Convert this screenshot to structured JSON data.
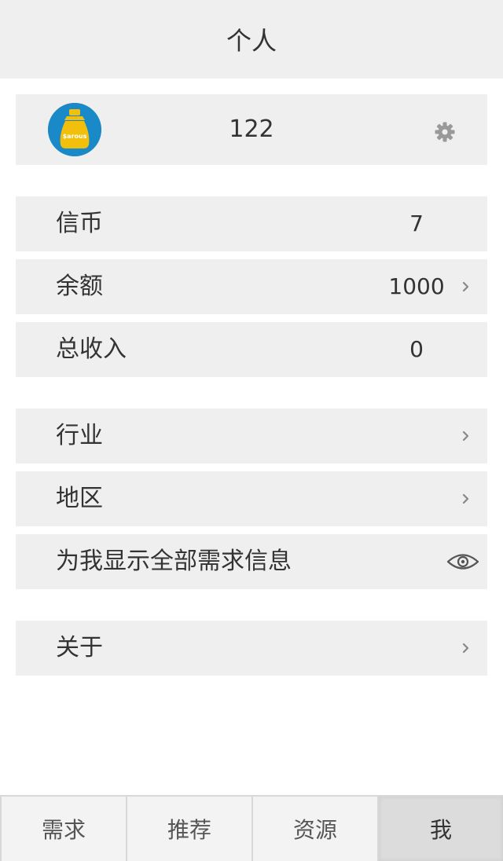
{
  "header": {
    "title": "个人"
  },
  "profile": {
    "username": "122",
    "avatar_text": "$arous",
    "avatar_colors": {
      "bg": "#1a89c7",
      "bag": "#f2c00c"
    },
    "settings_icon": "gear-icon"
  },
  "account": {
    "coins": {
      "label": "信币",
      "value": "7"
    },
    "balance": {
      "label": "余额",
      "value": "1000"
    },
    "income": {
      "label": "总收入",
      "value": "0"
    }
  },
  "settings": {
    "industry": {
      "label": "行业"
    },
    "region": {
      "label": "地区"
    },
    "show_all": {
      "label": "为我显示全部需求信息",
      "icon": "eye-icon"
    }
  },
  "about": {
    "label": "关于"
  },
  "tabs": [
    {
      "label": "需求"
    },
    {
      "label": "推荐"
    },
    {
      "label": "资源"
    },
    {
      "label": "我",
      "active": true
    }
  ]
}
